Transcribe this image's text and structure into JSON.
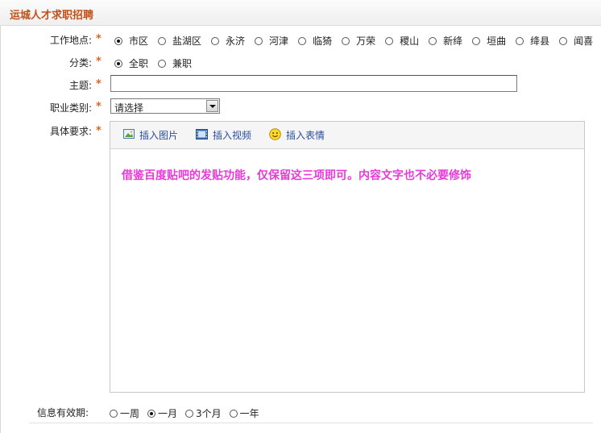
{
  "header": {
    "title": "运城人才求职招聘"
  },
  "form": {
    "location": {
      "label": "工作地点:",
      "options": [
        "市区",
        "盐湖区",
        "永济",
        "河津",
        "临猗",
        "万荣",
        "稷山",
        "新绛",
        "垣曲",
        "绛县",
        "闻喜"
      ],
      "selected": "市区"
    },
    "category": {
      "label": "分类:",
      "options": [
        "全职",
        "兼职"
      ],
      "selected": "全职"
    },
    "subject": {
      "label": "主题:",
      "value": ""
    },
    "job_type": {
      "label": "职业类别:",
      "selected": "请选择"
    },
    "requirements": {
      "label": "具体要求:",
      "toolbar": {
        "insert_image": "插入图片",
        "insert_video": "插入视频",
        "insert_emoji": "插入表情"
      },
      "note": "借鉴百度贴吧的发贴功能，仅保留这三项即可。内容文字也不必要修饰"
    },
    "validity": {
      "label": "信息有效期:",
      "options": [
        "一周",
        "一月",
        "3个月",
        "一年"
      ],
      "selected": "一月"
    },
    "required_mark": "*"
  },
  "colors": {
    "title": "#c0501a",
    "required": "#e0621c",
    "note": "#e73ad6",
    "toolbar_link": "#2a4f9a"
  }
}
